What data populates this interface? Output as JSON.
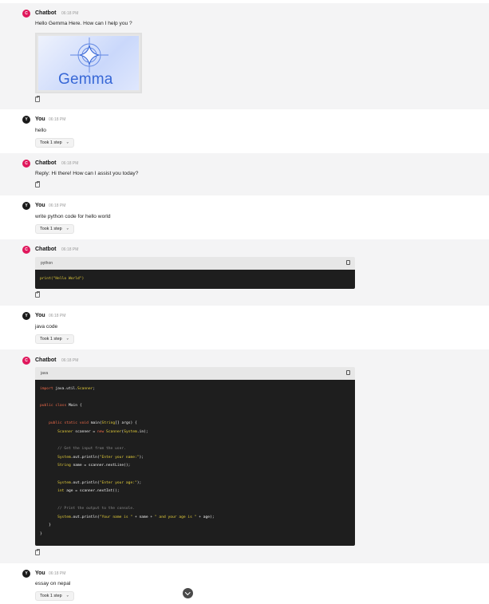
{
  "bot_name": "Chatbot",
  "user_name": "You",
  "avatar_bot": "C",
  "avatar_user": "Y",
  "time": "06:18 PM",
  "step_label": "Took 1 step",
  "msgs": {
    "m1": {
      "text": "Hello Gemma Here. How can I help you ?",
      "image_text": "Gemma"
    },
    "m2": {
      "text": "hello"
    },
    "m3": {
      "text": "Reply: Hi there! How can I assist you today?"
    },
    "m4": {
      "text": "write python code for hello world"
    },
    "m5": {
      "lang": "python",
      "code": [
        "print(\"Hello World\")"
      ]
    },
    "m6": {
      "text": "java code"
    },
    "m7": {
      "lang": "java",
      "code": [
        "import java.util.Scanner;",
        "",
        "public class Main {",
        "",
        "    public static void main(String[] args) {",
        "        Scanner scanner = new Scanner(System.in);",
        "",
        "        // Get the input from the user.",
        "        System.out.println(\"Enter your name:\");",
        "        String name = scanner.nextLine();",
        "",
        "        System.out.println(\"Enter your age:\");",
        "        int age = scanner.nextInt();",
        "",
        "        // Print the output to the console.",
        "        System.out.println(\"Your name is \" + name + \" and your age is \" + age);",
        "    }",
        "}"
      ]
    },
    "m8": {
      "text": "essay on nepal"
    }
  },
  "colors": {
    "bot_avatar": "#e0175c",
    "user_avatar": "#1a1a1a",
    "code_bg": "#1e1e1e"
  },
  "icons": {
    "copy": "copy-icon",
    "chevron": "chevron-down-icon",
    "scroll_down": "arrow-down-icon"
  }
}
